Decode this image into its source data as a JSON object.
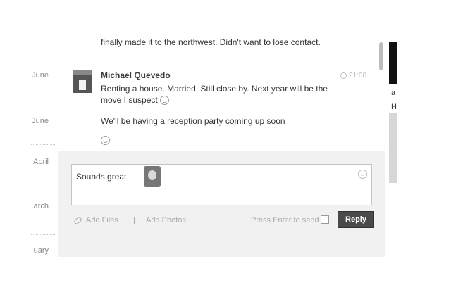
{
  "timeline": {
    "months": [
      "June",
      "June",
      "April",
      "arch",
      "uary"
    ]
  },
  "thread": {
    "cut_message": "finally made it to the northwest. Didn't want to lose contact.",
    "author": "Michael Quevedo",
    "time": "21:00",
    "message1": "Renting a house. Married. Still close by. Next year will be the move I suspect",
    "message2": "We'll be having a reception party coming up soon"
  },
  "compose": {
    "input_text": "Sounds great",
    "add_files": "Add Files",
    "add_photos": "Add Photos",
    "enter_to_send": "Press Enter to send",
    "reply": "Reply"
  },
  "right_panel": {
    "glyph1": "a",
    "glyph2": "H"
  }
}
